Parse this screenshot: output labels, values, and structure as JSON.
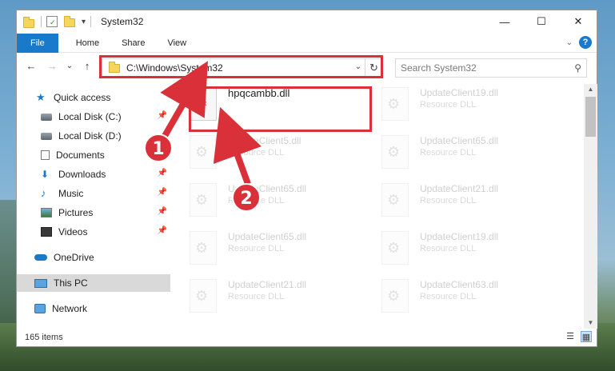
{
  "colors": {
    "accent": "#1979ca",
    "annotation": "#d9303a",
    "selection": "#d9d9d9"
  },
  "window": {
    "title": "System32",
    "buttons": {
      "minimize": "—",
      "maximize": "☐",
      "close": "✕"
    }
  },
  "ribbon": {
    "tabs": [
      {
        "label": "File"
      },
      {
        "label": "Home"
      },
      {
        "label": "Share"
      },
      {
        "label": "View"
      }
    ],
    "expand_icon": "chevron-down-icon",
    "help_label": "?"
  },
  "navigation": {
    "back": "←",
    "forward": "→",
    "recent": "⌄",
    "up": "↑",
    "address": "C:\\Windows\\System32",
    "search_placeholder": "Search System32"
  },
  "sidebar": {
    "items": [
      {
        "label": "Quick access",
        "icon": "star-icon"
      },
      {
        "label": "Local Disk (C:)",
        "icon": "disk-icon",
        "pinned": true
      },
      {
        "label": "Local Disk (D:)",
        "icon": "disk-icon"
      },
      {
        "label": "Documents",
        "icon": "document-icon"
      },
      {
        "label": "Downloads",
        "icon": "download-icon",
        "pinned": true
      },
      {
        "label": "Music",
        "icon": "music-icon",
        "pinned": true
      },
      {
        "label": "Pictures",
        "icon": "picture-icon",
        "pinned": true
      },
      {
        "label": "Videos",
        "icon": "video-icon",
        "pinned": true
      },
      {
        "label": "OneDrive",
        "icon": "cloud-icon"
      },
      {
        "label": "This PC",
        "icon": "computer-icon",
        "selected": true
      },
      {
        "label": "Network",
        "icon": "network-icon"
      }
    ]
  },
  "files": [
    {
      "name": "hpqcambb.dll",
      "type": ""
    },
    {
      "name": "UpdateClient19.dll",
      "type": "Resource DLL"
    },
    {
      "name": "UpdateClient5.dll",
      "type": "Resource DLL"
    },
    {
      "name": "UpdateClient65.dll",
      "type": "Resource DLL"
    },
    {
      "name": "UpdateClient65.dll",
      "type": "Resource DLL"
    },
    {
      "name": "UpdateClient21.dll",
      "type": "Resource DLL"
    },
    {
      "name": "UpdateClient65.dll",
      "type": "Resource DLL"
    },
    {
      "name": "UpdateClient19.dll",
      "type": "Resource DLL"
    },
    {
      "name": "UpdateClient21.dll",
      "type": "Resource DLL"
    },
    {
      "name": "UpdateClient63.dll",
      "type": "Resource DLL"
    }
  ],
  "status": {
    "item_count": "165 items"
  },
  "annotations": {
    "callout_1": "1",
    "callout_2": "2"
  }
}
